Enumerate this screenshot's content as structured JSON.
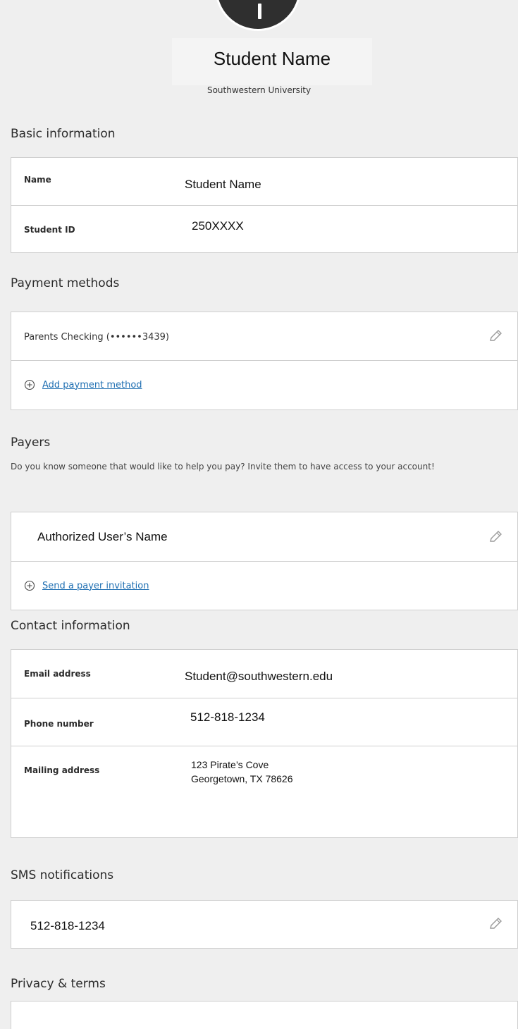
{
  "profile": {
    "name": "Student Name",
    "school": "Southwestern University"
  },
  "basic_info": {
    "title": "Basic information",
    "rows": [
      {
        "label": "Name",
        "value": "Student Name"
      },
      {
        "label": "Student ID",
        "value": "250XXXX"
      }
    ]
  },
  "payment_methods": {
    "title": "Payment methods",
    "method": "Parents Checking (••••••3439)",
    "add_label": "Add payment method"
  },
  "payers": {
    "title": "Payers",
    "description": "Do you know someone that would like to help you pay? Invite them to have access to your account!",
    "payer": "Authorized User’s  Name",
    "invite_label": "Send a payer invitation"
  },
  "contact": {
    "title": "Contact information",
    "email_label": "Email address",
    "email": "Student@southwestern.edu",
    "phone_label": "Phone number",
    "phone": "512-818-1234",
    "address_label": "Mailing address",
    "address_line1": "123 Pirate’s Cove",
    "address_line2": "Georgetown, TX 78626"
  },
  "sms": {
    "title": "SMS notifications",
    "number": "512-818-1234"
  },
  "privacy": {
    "title": "Privacy & terms"
  },
  "icons": {
    "edit": "pencil-icon",
    "add": "circle-plus-icon"
  },
  "colors": {
    "background": "#efefef",
    "link": "#1f6fb2",
    "avatar": "#2f2f2f"
  }
}
